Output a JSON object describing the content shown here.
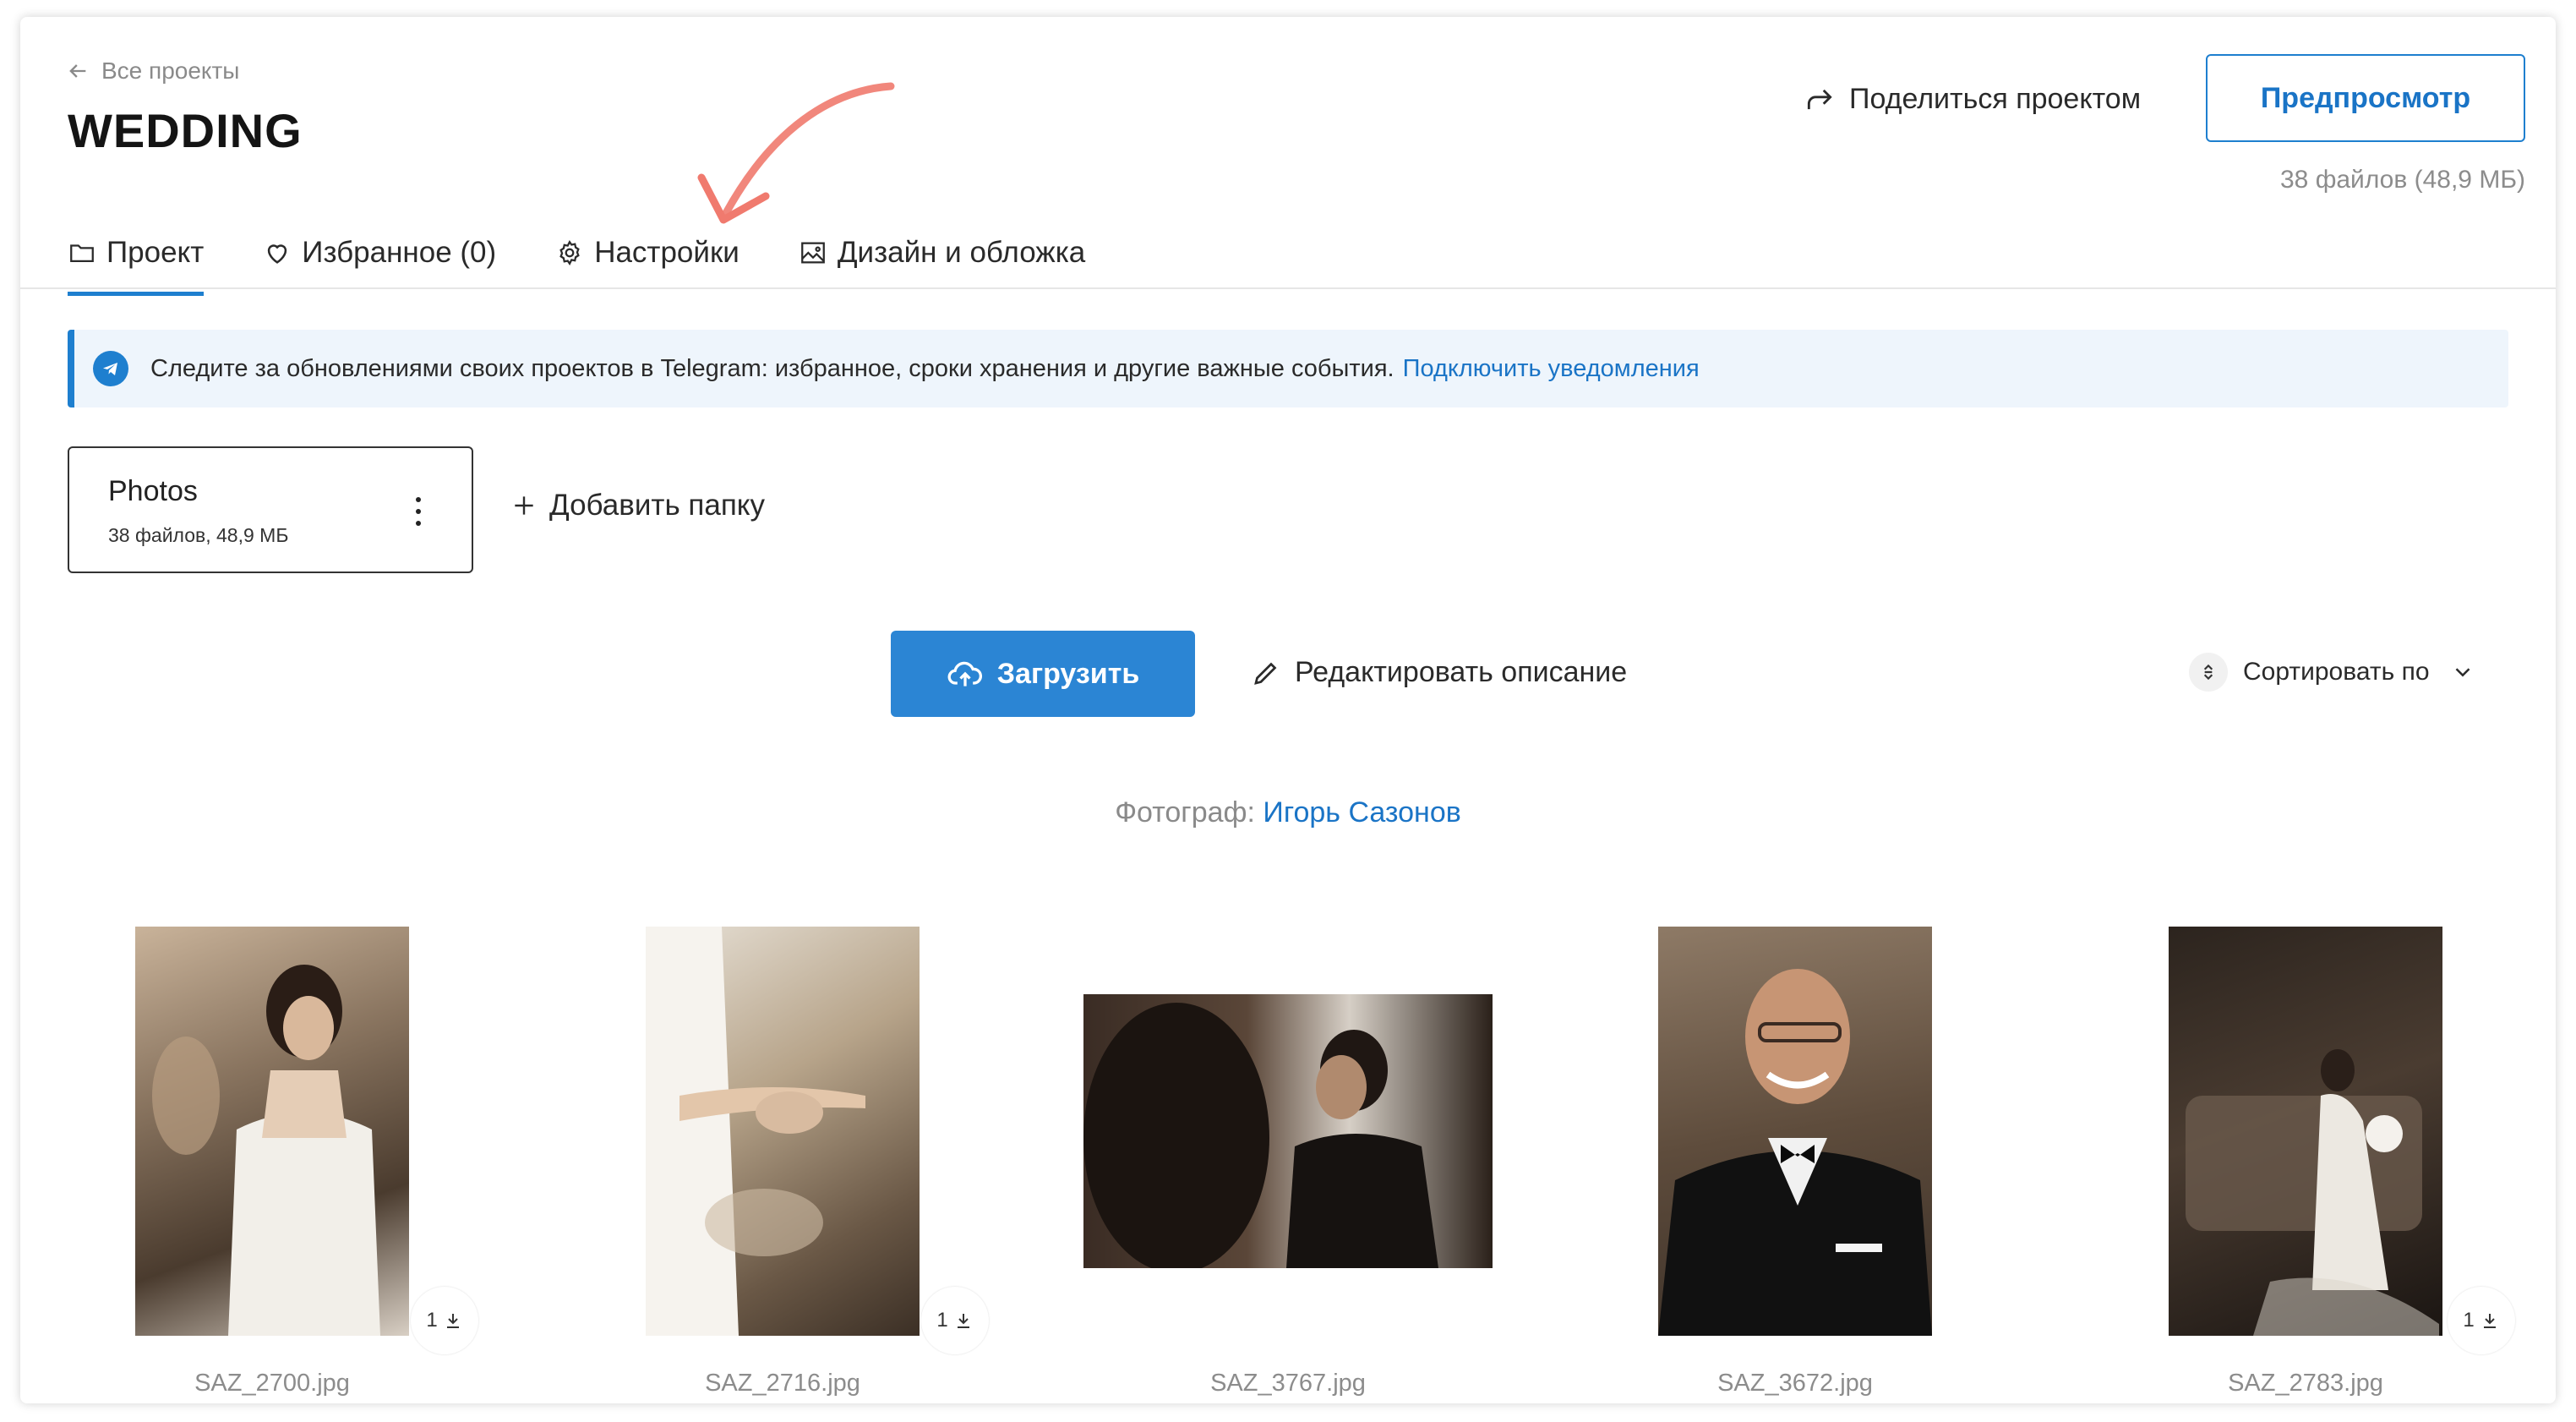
{
  "header": {
    "back_label": "Все проекты",
    "project_title": "WEDDING",
    "share_label": "Поделиться проектом",
    "preview_label": "Предпросмотр",
    "files_summary": "38 файлов (48,9 МБ)"
  },
  "tabs": [
    {
      "label": "Проект",
      "icon": "folder-icon",
      "active": true
    },
    {
      "label": "Избранное (0)",
      "icon": "heart-icon",
      "active": false
    },
    {
      "label": "Настройки",
      "icon": "gear-icon",
      "active": false
    },
    {
      "label": "Дизайн и обложка",
      "icon": "image-icon",
      "active": false
    }
  ],
  "banner": {
    "text": "Следите за обновлениями своих проектов в Telegram: избранное, сроки хранения и другие важные события.",
    "link_label": "Подключить уведомления",
    "icon": "telegram-icon"
  },
  "folder": {
    "name": "Photos",
    "meta": "38 файлов, 48,9 МБ"
  },
  "add_folder_label": "Добавить папку",
  "actions": {
    "upload_label": "Загрузить",
    "edit_description_label": "Редактировать описание",
    "sort_label": "Сортировать по"
  },
  "photographer": {
    "prefix": "Фотограф:",
    "name": "Игорь Сазонов"
  },
  "photos": [
    {
      "name": "SAZ_2700.jpg",
      "downloads": "1"
    },
    {
      "name": "SAZ_2716.jpg",
      "downloads": "1"
    },
    {
      "name": "SAZ_3767.jpg",
      "downloads": ""
    },
    {
      "name": "SAZ_3672.jpg",
      "downloads": ""
    },
    {
      "name": "SAZ_2783.jpg",
      "downloads": "1"
    }
  ],
  "colors": {
    "accent": "#1e7fcf",
    "upload_button": "#2b85d4",
    "banner_bg": "#eef5fc",
    "annotation_arrow": "#f07a6e"
  }
}
